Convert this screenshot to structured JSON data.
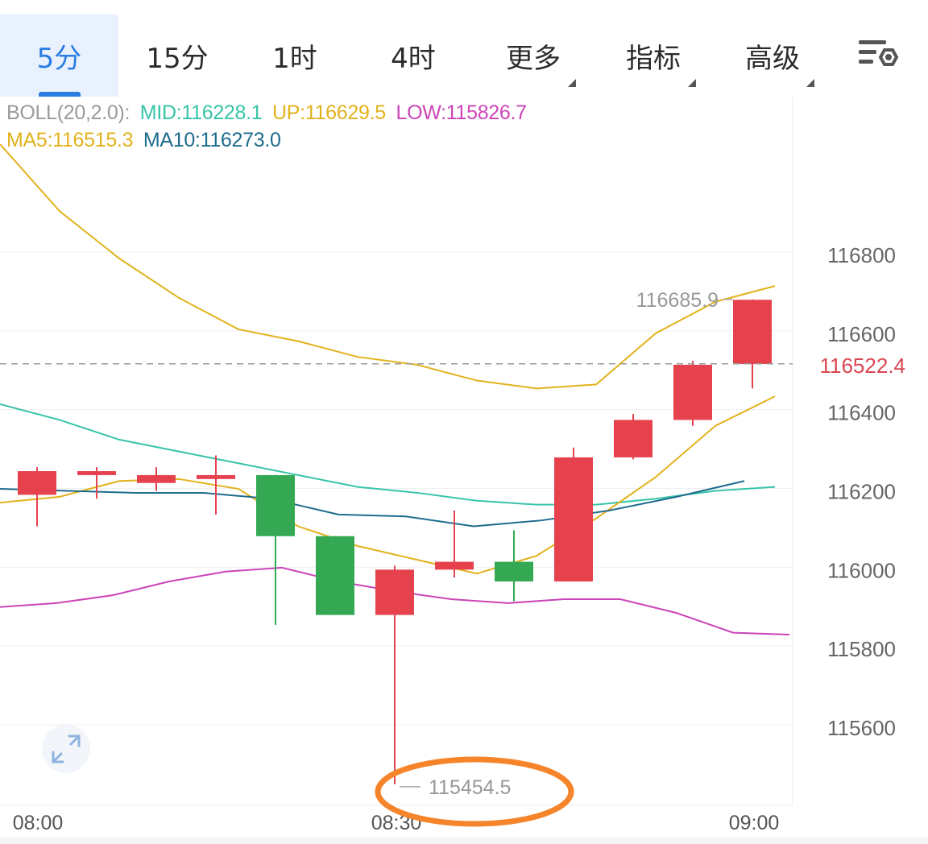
{
  "tabs": [
    {
      "label": "5分",
      "active": true,
      "has_caret": false
    },
    {
      "label": "15分",
      "active": false,
      "has_caret": false
    },
    {
      "label": "1时",
      "active": false,
      "has_caret": false
    },
    {
      "label": "4时",
      "active": false,
      "has_caret": false
    },
    {
      "label": "更多",
      "active": false,
      "has_caret": true
    },
    {
      "label": "指标",
      "active": false,
      "has_caret": true
    },
    {
      "label": "高级",
      "active": false,
      "has_caret": true
    }
  ],
  "settings_icon": "chart-settings-icon",
  "indicators": {
    "boll": {
      "prefix": "BOLL(20,2.0):",
      "mid": "MID:116228.1",
      "up": "UP:116629.5",
      "low": "LOW:115826.7"
    },
    "ma": {
      "ma5": "MA5:116515.3",
      "ma10": "MA10:116273.0"
    }
  },
  "colors": {
    "up": "#e5424e",
    "down": "#35a853",
    "mid": "#37c4a8",
    "upper": "#e2b21c",
    "lower": "#cc44b8",
    "ma5": "#e2b21c",
    "ma10": "#1e6c8e",
    "active_tab": "#2a7de1",
    "annotation": "#f5842a"
  },
  "price_marker": {
    "label": "116522.4",
    "value": 116522.4
  },
  "high_label": "116685.9",
  "low_label": "115454.5",
  "expand_icon": "expand-arrows-icon",
  "chart_data": {
    "type": "candlestick",
    "y_ticks": [
      "116800",
      "116600",
      "116400",
      "116200",
      "116000",
      "115800",
      "115600"
    ],
    "x_ticks": [
      "08:00",
      "08:30",
      "09:00"
    ],
    "ylim": [
      115400,
      117200
    ],
    "candles": [
      {
        "o": 116190,
        "h": 116260,
        "l": 116110,
        "c": 116250
      },
      {
        "o": 116240,
        "h": 116260,
        "l": 116180,
        "c": 116250
      },
      {
        "o": 116220,
        "h": 116260,
        "l": 116200,
        "c": 116240
      },
      {
        "o": 116230,
        "h": 116290,
        "l": 116140,
        "c": 116240
      },
      {
        "o": 116240,
        "h": 116240,
        "l": 115860,
        "c": 116085
      },
      {
        "o": 116085,
        "h": 116085,
        "l": 115885,
        "c": 115885
      },
      {
        "o": 115885,
        "h": 116010,
        "l": 115455,
        "c": 116000
      },
      {
        "o": 116000,
        "h": 116150,
        "l": 115980,
        "c": 116020
      },
      {
        "o": 116020,
        "h": 116100,
        "l": 115920,
        "c": 115970
      },
      {
        "o": 115970,
        "h": 116310,
        "l": 115970,
        "c": 116285
      },
      {
        "o": 116285,
        "h": 116395,
        "l": 116280,
        "c": 116380
      },
      {
        "o": 116380,
        "h": 116530,
        "l": 116365,
        "c": 116520
      },
      {
        "o": 116522,
        "h": 116686,
        "l": 116460,
        "c": 116685
      }
    ],
    "upper": [
      117080,
      116910,
      116790,
      116690,
      116610,
      116580,
      116540,
      116520,
      116480,
      116460,
      116470,
      116600,
      116680,
      116720
    ],
    "mid": [
      116420,
      116380,
      116330,
      116300,
      116270,
      116240,
      116210,
      116195,
      116175,
      116165,
      116165,
      116180,
      116200,
      116210
    ],
    "lower": [
      115905,
      115915,
      115935,
      115970,
      115995,
      116005,
      115970,
      115945,
      115925,
      115915,
      115925,
      115925,
      115890,
      115840,
      115835
    ],
    "ma5": [
      116170,
      116185,
      116225,
      116230,
      116205,
      116110,
      116060,
      116025,
      115990,
      116035,
      116130,
      116235,
      116365,
      116440
    ],
    "ma10": [
      116205,
      116200,
      116195,
      116195,
      116180,
      116140,
      116135,
      116110,
      116125,
      116150,
      116185,
      116225
    ]
  }
}
